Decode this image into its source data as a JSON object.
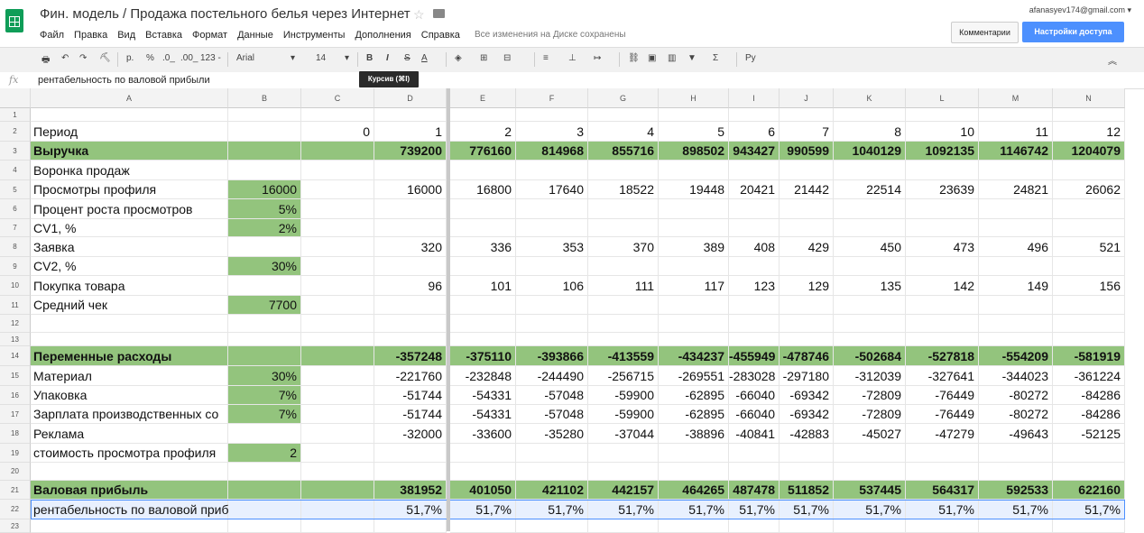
{
  "header": {
    "title": "Фин. модель / Продажа постельного белья через Интернет",
    "account": "afanasyev174@gmail.com ▾",
    "saved_status": "Все изменения на Диске сохранены",
    "comments_label": "Комментарии",
    "share_label": "Настройки доступа",
    "menu": [
      "Файл",
      "Правка",
      "Вид",
      "Вставка",
      "Формат",
      "Данные",
      "Инструменты",
      "Дополнения",
      "Справка"
    ]
  },
  "toolbar": {
    "font": "Arial",
    "font_size": "14",
    "percent": "%",
    "dec_less": ".0_",
    "dec_more": ".00_",
    "number_format": "123 -",
    "currency": "р.",
    "bold": "B",
    "italic": "I",
    "strike": "S",
    "text_color": "A",
    "input_tools": "Ру",
    "tooltip": "Курсив (⌘I)"
  },
  "formula_bar": {
    "fx": "fx",
    "value": "рентабельность по валовой прибыли"
  },
  "columns": [
    "A",
    "B",
    "C",
    "D",
    "E",
    "F",
    "G",
    "H",
    "I",
    "J",
    "K",
    "L",
    "M",
    "N"
  ],
  "rows": [
    {
      "n": "1",
      "cells": [
        "",
        "",
        "",
        "",
        "",
        "",
        "",
        "",
        "",
        "",
        "",
        "",
        "",
        ""
      ]
    },
    {
      "n": "2",
      "cells": [
        "Период",
        "",
        "0",
        "1",
        "2",
        "3",
        "4",
        "5",
        "6",
        "7",
        "8",
        "10",
        "11",
        "12"
      ]
    },
    {
      "n": "3",
      "green": true,
      "bold": true,
      "cells": [
        "Выручка",
        "",
        "",
        "739200",
        "776160",
        "814968",
        "855716",
        "898502",
        "943427",
        "990599",
        "1040129",
        "1092135",
        "1146742",
        "1204079"
      ]
    },
    {
      "n": "4",
      "cells": [
        "Воронка продаж",
        "",
        "",
        "",
        "",
        "",
        "",
        "",
        "",
        "",
        "",
        "",
        "",
        ""
      ]
    },
    {
      "n": "5",
      "cells": [
        "Просмотры профиля",
        "16000",
        "",
        "16000",
        "16800",
        "17640",
        "18522",
        "19448",
        "20421",
        "21442",
        "22514",
        "23639",
        "24821",
        "26062"
      ]
    },
    {
      "n": "6",
      "cells": [
        "Процент роста просмотров",
        "5%",
        "",
        "",
        "",
        "",
        "",
        "",
        "",
        "",
        "",
        "",
        "",
        ""
      ]
    },
    {
      "n": "7",
      "cells": [
        "CV1, %",
        "2%",
        "",
        "",
        "",
        "",
        "",
        "",
        "",
        "",
        "",
        "",
        "",
        ""
      ]
    },
    {
      "n": "8",
      "cells": [
        "Заявка",
        "",
        "",
        "320",
        "336",
        "353",
        "370",
        "389",
        "408",
        "429",
        "450",
        "473",
        "496",
        "521"
      ]
    },
    {
      "n": "9",
      "cells": [
        "CV2, %",
        "30%",
        "",
        "",
        "",
        "",
        "",
        "",
        "",
        "",
        "",
        "",
        "",
        ""
      ]
    },
    {
      "n": "10",
      "cells": [
        "Покупка товара",
        "",
        "",
        "96",
        "101",
        "106",
        "111",
        "117",
        "123",
        "129",
        "135",
        "142",
        "149",
        "156"
      ]
    },
    {
      "n": "11",
      "cells": [
        "Средний чек",
        "7700",
        "",
        "",
        "",
        "",
        "",
        "",
        "",
        "",
        "",
        "",
        "",
        ""
      ]
    },
    {
      "n": "12",
      "cells": [
        "",
        "",
        "",
        "",
        "",
        "",
        "",
        "",
        "",
        "",
        "",
        "",
        "",
        ""
      ]
    },
    {
      "n": "13",
      "cells": [
        "",
        "",
        "",
        "",
        "",
        "",
        "",
        "",
        "",
        "",
        "",
        "",
        "",
        ""
      ]
    },
    {
      "n": "14",
      "green": true,
      "bold": true,
      "cells": [
        "Переменные расходы",
        "",
        "",
        "-357248",
        "-375110",
        "-393866",
        "-413559",
        "-434237",
        "-455949",
        "-478746",
        "-502684",
        "-527818",
        "-554209",
        "-581919"
      ]
    },
    {
      "n": "15",
      "cells": [
        "Материал",
        "30%",
        "",
        "-221760",
        "-232848",
        "-244490",
        "-256715",
        "-269551",
        "-283028",
        "-297180",
        "-312039",
        "-327641",
        "-344023",
        "-361224"
      ]
    },
    {
      "n": "16",
      "cells": [
        "Упаковка",
        "7%",
        "",
        "-51744",
        "-54331",
        "-57048",
        "-59900",
        "-62895",
        "-66040",
        "-69342",
        "-72809",
        "-76449",
        "-80272",
        "-84286"
      ]
    },
    {
      "n": "17",
      "cells": [
        "Зарплата производственных со",
        "7%",
        "",
        "-51744",
        "-54331",
        "-57048",
        "-59900",
        "-62895",
        "-66040",
        "-69342",
        "-72809",
        "-76449",
        "-80272",
        "-84286"
      ]
    },
    {
      "n": "18",
      "cells": [
        "Реклама",
        "",
        "",
        "-32000",
        "-33600",
        "-35280",
        "-37044",
        "-38896",
        "-40841",
        "-42883",
        "-45027",
        "-47279",
        "-49643",
        "-52125"
      ]
    },
    {
      "n": "19",
      "cells": [
        "стоимость просмотра профиля",
        "2",
        "",
        "",
        "",
        "",
        "",
        "",
        "",
        "",
        "",
        "",
        "",
        ""
      ]
    },
    {
      "n": "20",
      "cells": [
        "",
        "",
        "",
        "",
        "",
        "",
        "",
        "",
        "",
        "",
        "",
        "",
        "",
        ""
      ]
    },
    {
      "n": "21",
      "green": true,
      "bold": true,
      "cells": [
        "Валовая прибыль",
        "",
        "",
        "381952",
        "401050",
        "421102",
        "442157",
        "464265",
        "487478",
        "511852",
        "537445",
        "564317",
        "592533",
        "622160"
      ]
    },
    {
      "n": "22",
      "selected": true,
      "cells": [
        "рентабельность по валовой прибыли",
        "",
        "",
        "51,7%",
        "51,7%",
        "51,7%",
        "51,7%",
        "51,7%",
        "51,7%",
        "51,7%",
        "51,7%",
        "51,7%",
        "51,7%",
        "51,7%"
      ]
    },
    {
      "n": "23",
      "cells": [
        "",
        "",
        "",
        "",
        "",
        "",
        "",
        "",
        "",
        "",
        "",
        "",
        "",
        ""
      ]
    }
  ],
  "green_input_cells": [
    "B5",
    "B6",
    "B7",
    "B9",
    "B11",
    "B15",
    "B16",
    "B17",
    "B19"
  ],
  "colors": {
    "green": "#93c47d",
    "accent": "#4d90fe",
    "sheets_green": "#0f9d58"
  }
}
